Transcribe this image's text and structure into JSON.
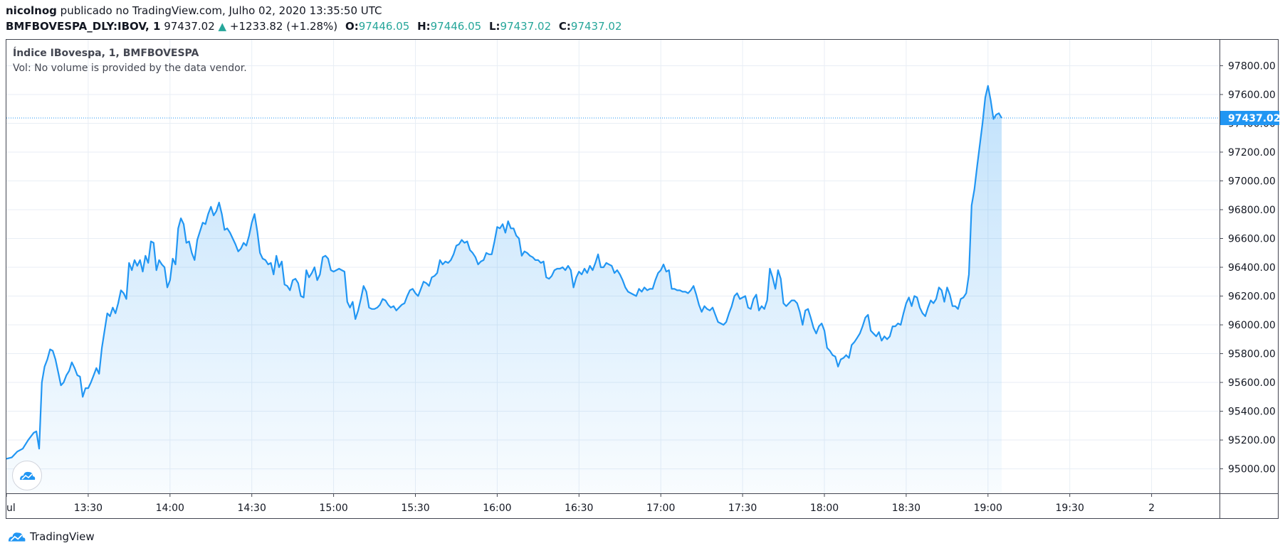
{
  "header": {
    "user": "nicolnog",
    "published": "publicado no TradingView.com, Julho 02, 2020 13:35:50 UTC",
    "symbol": "BMFBOVESPA_DLY:IBOV, 1",
    "price": "97437.02",
    "change_arrow": "▲",
    "change": "+1233.82 (+1.28%)",
    "o_label": "O:",
    "o_value": "97446.05",
    "h_label": "H:",
    "h_value": "97446.05",
    "l_label": "L:",
    "l_value": "97437.02",
    "c_label": "C:",
    "c_value": "97437.02"
  },
  "legend": {
    "title": "Índice IBovespa, 1, BMFBOVESPA",
    "volume": "Vol: No volume is provided by the data vendor."
  },
  "branding": {
    "name": "TradingView",
    "icon": "tradingview-cloud-icon"
  },
  "colors": {
    "line": "#2196f3",
    "fill": "#2196f3",
    "last_price_bg": "#2196f3",
    "up": "#26a69a",
    "grid": "#e8eef5"
  },
  "chart_data": {
    "type": "area",
    "x_tick_labels": [
      "ul",
      "13:30",
      "14:00",
      "14:30",
      "15:00",
      "15:30",
      "16:00",
      "16:30",
      "17:00",
      "17:30",
      "18:00",
      "18:30",
      "19:00",
      "19:30",
      "2"
    ],
    "x_tick_pos": [
      0,
      30,
      60,
      90,
      120,
      150,
      180,
      210,
      240,
      270,
      300,
      330,
      360,
      390,
      420
    ],
    "y_ticks": [
      95000,
      95200,
      95400,
      95600,
      95800,
      96000,
      96200,
      96400,
      96600,
      96800,
      97000,
      97200,
      97400,
      97600,
      97800
    ],
    "y_tick_labels": [
      "95000.00",
      "95200.00",
      "95400.00",
      "95600.00",
      "95800.00",
      "96000.00",
      "96200.00",
      "96400.00",
      "96600.00",
      "96800.00",
      "97000.00",
      "97200.00",
      "97400.00",
      "97600.00",
      "97800.00"
    ],
    "ylim": [
      94830,
      97980
    ],
    "xlim": [
      0,
      445
    ],
    "last_price": 97437.02,
    "last_price_label": "97437.02",
    "points": [
      [
        0,
        95070
      ],
      [
        2,
        95080
      ],
      [
        4,
        95120
      ],
      [
        6,
        95140
      ],
      [
        8,
        95200
      ],
      [
        10,
        95250
      ],
      [
        11,
        95260
      ],
      [
        12,
        95140
      ],
      [
        13,
        95600
      ],
      [
        14,
        95710
      ],
      [
        15,
        95760
      ],
      [
        16,
        95830
      ],
      [
        17,
        95820
      ],
      [
        18,
        95760
      ],
      [
        19,
        95670
      ],
      [
        20,
        95580
      ],
      [
        21,
        95600
      ],
      [
        22,
        95650
      ],
      [
        23,
        95680
      ],
      [
        24,
        95740
      ],
      [
        25,
        95700
      ],
      [
        26,
        95650
      ],
      [
        27,
        95640
      ],
      [
        28,
        95500
      ],
      [
        29,
        95560
      ],
      [
        30,
        95560
      ],
      [
        31,
        95600
      ],
      [
        32,
        95650
      ],
      [
        33,
        95700
      ],
      [
        34,
        95660
      ],
      [
        35,
        95840
      ],
      [
        36,
        95960
      ],
      [
        37,
        96080
      ],
      [
        38,
        96060
      ],
      [
        39,
        96120
      ],
      [
        40,
        96080
      ],
      [
        41,
        96150
      ],
      [
        42,
        96240
      ],
      [
        43,
        96220
      ],
      [
        44,
        96180
      ],
      [
        45,
        96430
      ],
      [
        46,
        96380
      ],
      [
        47,
        96450
      ],
      [
        48,
        96410
      ],
      [
        49,
        96450
      ],
      [
        50,
        96370
      ],
      [
        51,
        96480
      ],
      [
        52,
        96430
      ],
      [
        53,
        96580
      ],
      [
        54,
        96570
      ],
      [
        55,
        96380
      ],
      [
        56,
        96450
      ],
      [
        57,
        96420
      ],
      [
        58,
        96400
      ],
      [
        59,
        96260
      ],
      [
        60,
        96310
      ],
      [
        61,
        96460
      ],
      [
        62,
        96420
      ],
      [
        63,
        96670
      ],
      [
        64,
        96740
      ],
      [
        65,
        96700
      ],
      [
        66,
        96570
      ],
      [
        67,
        96580
      ],
      [
        68,
        96500
      ],
      [
        69,
        96450
      ],
      [
        70,
        96590
      ],
      [
        71,
        96650
      ],
      [
        72,
        96710
      ],
      [
        73,
        96700
      ],
      [
        74,
        96770
      ],
      [
        75,
        96820
      ],
      [
        76,
        96760
      ],
      [
        77,
        96790
      ],
      [
        78,
        96850
      ],
      [
        79,
        96770
      ],
      [
        80,
        96660
      ],
      [
        81,
        96670
      ],
      [
        82,
        96640
      ],
      [
        83,
        96600
      ],
      [
        84,
        96560
      ],
      [
        85,
        96510
      ],
      [
        86,
        96530
      ],
      [
        87,
        96570
      ],
      [
        88,
        96550
      ],
      [
        89,
        96620
      ],
      [
        90,
        96710
      ],
      [
        91,
        96770
      ],
      [
        92,
        96650
      ],
      [
        93,
        96500
      ],
      [
        94,
        96460
      ],
      [
        95,
        96450
      ],
      [
        96,
        96420
      ],
      [
        97,
        96430
      ],
      [
        98,
        96350
      ],
      [
        99,
        96480
      ],
      [
        100,
        96400
      ],
      [
        101,
        96440
      ],
      [
        102,
        96280
      ],
      [
        103,
        96270
      ],
      [
        104,
        96240
      ],
      [
        105,
        96310
      ],
      [
        106,
        96320
      ],
      [
        107,
        96290
      ],
      [
        108,
        96200
      ],
      [
        109,
        96190
      ],
      [
        110,
        96380
      ],
      [
        111,
        96330
      ],
      [
        112,
        96360
      ],
      [
        113,
        96400
      ],
      [
        114,
        96310
      ],
      [
        115,
        96350
      ],
      [
        116,
        96470
      ],
      [
        117,
        96480
      ],
      [
        118,
        96460
      ],
      [
        119,
        96380
      ],
      [
        120,
        96370
      ],
      [
        121,
        96380
      ],
      [
        122,
        96390
      ],
      [
        123,
        96380
      ],
      [
        124,
        96370
      ],
      [
        125,
        96160
      ],
      [
        126,
        96120
      ],
      [
        127,
        96160
      ],
      [
        128,
        96040
      ],
      [
        129,
        96100
      ],
      [
        130,
        96180
      ],
      [
        131,
        96270
      ],
      [
        132,
        96230
      ],
      [
        133,
        96120
      ],
      [
        134,
        96110
      ],
      [
        135,
        96110
      ],
      [
        136,
        96120
      ],
      [
        137,
        96140
      ],
      [
        138,
        96180
      ],
      [
        139,
        96170
      ],
      [
        140,
        96140
      ],
      [
        141,
        96120
      ],
      [
        142,
        96130
      ],
      [
        143,
        96100
      ],
      [
        144,
        96120
      ],
      [
        145,
        96140
      ],
      [
        146,
        96150
      ],
      [
        147,
        96200
      ],
      [
        148,
        96240
      ],
      [
        149,
        96250
      ],
      [
        150,
        96220
      ],
      [
        151,
        96200
      ],
      [
        152,
        96250
      ],
      [
        153,
        96300
      ],
      [
        154,
        96290
      ],
      [
        155,
        96270
      ],
      [
        156,
        96330
      ],
      [
        157,
        96340
      ],
      [
        158,
        96360
      ],
      [
        159,
        96450
      ],
      [
        160,
        96420
      ],
      [
        161,
        96440
      ],
      [
        162,
        96430
      ],
      [
        163,
        96450
      ],
      [
        164,
        96490
      ],
      [
        165,
        96550
      ],
      [
        166,
        96560
      ],
      [
        167,
        96590
      ],
      [
        168,
        96570
      ],
      [
        169,
        96580
      ],
      [
        170,
        96520
      ],
      [
        171,
        96500
      ],
      [
        172,
        96470
      ],
      [
        173,
        96420
      ],
      [
        174,
        96440
      ],
      [
        175,
        96450
      ],
      [
        176,
        96500
      ],
      [
        177,
        96490
      ],
      [
        178,
        96490
      ],
      [
        179,
        96580
      ],
      [
        180,
        96680
      ],
      [
        181,
        96670
      ],
      [
        182,
        96700
      ],
      [
        183,
        96640
      ],
      [
        184,
        96720
      ],
      [
        185,
        96670
      ],
      [
        186,
        96670
      ],
      [
        187,
        96620
      ],
      [
        188,
        96600
      ],
      [
        189,
        96480
      ],
      [
        190,
        96510
      ],
      [
        191,
        96500
      ],
      [
        192,
        96480
      ],
      [
        193,
        96470
      ],
      [
        194,
        96450
      ],
      [
        195,
        96450
      ],
      [
        196,
        96430
      ],
      [
        197,
        96440
      ],
      [
        198,
        96330
      ],
      [
        199,
        96320
      ],
      [
        200,
        96340
      ],
      [
        201,
        96380
      ],
      [
        202,
        96390
      ],
      [
        203,
        96390
      ],
      [
        204,
        96400
      ],
      [
        205,
        96380
      ],
      [
        206,
        96410
      ],
      [
        207,
        96380
      ],
      [
        208,
        96260
      ],
      [
        209,
        96330
      ],
      [
        210,
        96370
      ],
      [
        211,
        96350
      ],
      [
        212,
        96390
      ],
      [
        213,
        96360
      ],
      [
        214,
        96410
      ],
      [
        215,
        96380
      ],
      [
        216,
        96430
      ],
      [
        217,
        96490
      ],
      [
        218,
        96400
      ],
      [
        219,
        96400
      ],
      [
        220,
        96430
      ],
      [
        221,
        96420
      ],
      [
        222,
        96410
      ],
      [
        223,
        96360
      ],
      [
        224,
        96380
      ],
      [
        225,
        96350
      ],
      [
        226,
        96310
      ],
      [
        227,
        96260
      ],
      [
        228,
        96230
      ],
      [
        229,
        96220
      ],
      [
        230,
        96210
      ],
      [
        231,
        96200
      ],
      [
        232,
        96250
      ],
      [
        233,
        96230
      ],
      [
        234,
        96260
      ],
      [
        235,
        96240
      ],
      [
        236,
        96250
      ],
      [
        237,
        96250
      ],
      [
        238,
        96310
      ],
      [
        239,
        96360
      ],
      [
        240,
        96380
      ],
      [
        241,
        96420
      ],
      [
        242,
        96370
      ],
      [
        243,
        96380
      ],
      [
        244,
        96250
      ],
      [
        245,
        96250
      ],
      [
        246,
        96240
      ],
      [
        247,
        96240
      ],
      [
        248,
        96230
      ],
      [
        249,
        96230
      ],
      [
        250,
        96220
      ],
      [
        251,
        96240
      ],
      [
        252,
        96270
      ],
      [
        253,
        96210
      ],
      [
        254,
        96140
      ],
      [
        255,
        96090
      ],
      [
        256,
        96130
      ],
      [
        257,
        96110
      ],
      [
        258,
        96100
      ],
      [
        259,
        96120
      ],
      [
        260,
        96070
      ],
      [
        261,
        96020
      ],
      [
        262,
        96010
      ],
      [
        263,
        96000
      ],
      [
        264,
        96020
      ],
      [
        265,
        96080
      ],
      [
        266,
        96130
      ],
      [
        267,
        96200
      ],
      [
        268,
        96220
      ],
      [
        269,
        96180
      ],
      [
        270,
        96190
      ],
      [
        271,
        96200
      ],
      [
        272,
        96120
      ],
      [
        273,
        96110
      ],
      [
        274,
        96180
      ],
      [
        275,
        96210
      ],
      [
        276,
        96100
      ],
      [
        277,
        96130
      ],
      [
        278,
        96110
      ],
      [
        279,
        96170
      ],
      [
        280,
        96390
      ],
      [
        281,
        96330
      ],
      [
        282,
        96250
      ],
      [
        283,
        96380
      ],
      [
        284,
        96320
      ],
      [
        285,
        96150
      ],
      [
        286,
        96130
      ],
      [
        287,
        96150
      ],
      [
        288,
        96170
      ],
      [
        289,
        96170
      ],
      [
        290,
        96150
      ],
      [
        291,
        96090
      ],
      [
        292,
        96000
      ],
      [
        293,
        96100
      ],
      [
        294,
        96110
      ],
      [
        295,
        96050
      ],
      [
        296,
        95980
      ],
      [
        297,
        95940
      ],
      [
        298,
        95990
      ],
      [
        299,
        96010
      ],
      [
        300,
        95960
      ],
      [
        301,
        95840
      ],
      [
        302,
        95820
      ],
      [
        303,
        95790
      ],
      [
        304,
        95780
      ],
      [
        305,
        95710
      ],
      [
        306,
        95760
      ],
      [
        307,
        95770
      ],
      [
        308,
        95790
      ],
      [
        309,
        95770
      ],
      [
        310,
        95860
      ],
      [
        311,
        95880
      ],
      [
        312,
        95910
      ],
      [
        313,
        95940
      ],
      [
        314,
        95990
      ],
      [
        315,
        96050
      ],
      [
        316,
        96070
      ],
      [
        317,
        95960
      ],
      [
        318,
        95940
      ],
      [
        319,
        95920
      ],
      [
        320,
        95950
      ],
      [
        321,
        95890
      ],
      [
        322,
        95920
      ],
      [
        323,
        95900
      ],
      [
        324,
        95920
      ],
      [
        325,
        95990
      ],
      [
        326,
        95990
      ],
      [
        327,
        96010
      ],
      [
        328,
        96000
      ],
      [
        329,
        96080
      ],
      [
        330,
        96150
      ],
      [
        331,
        96190
      ],
      [
        332,
        96130
      ],
      [
        333,
        96200
      ],
      [
        334,
        96190
      ],
      [
        335,
        96120
      ],
      [
        336,
        96080
      ],
      [
        337,
        96060
      ],
      [
        338,
        96120
      ],
      [
        339,
        96170
      ],
      [
        340,
        96150
      ],
      [
        341,
        96180
      ],
      [
        342,
        96260
      ],
      [
        343,
        96240
      ],
      [
        344,
        96160
      ],
      [
        345,
        96260
      ],
      [
        346,
        96210
      ],
      [
        347,
        96130
      ],
      [
        348,
        96130
      ],
      [
        349,
        96110
      ],
      [
        350,
        96180
      ],
      [
        351,
        96190
      ],
      [
        352,
        96220
      ],
      [
        353,
        96350
      ],
      [
        354,
        96830
      ],
      [
        355,
        96940
      ],
      [
        356,
        97100
      ],
      [
        357,
        97250
      ],
      [
        358,
        97400
      ],
      [
        359,
        97580
      ],
      [
        360,
        97660
      ],
      [
        361,
        97560
      ],
      [
        362,
        97430
      ],
      [
        363,
        97460
      ],
      [
        364,
        97470
      ],
      [
        365,
        97437
      ]
    ]
  }
}
